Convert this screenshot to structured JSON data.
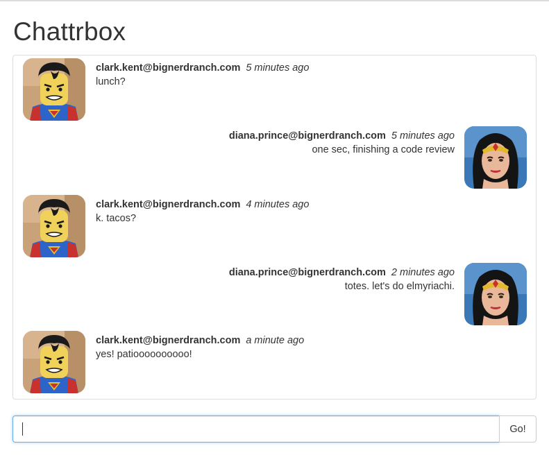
{
  "app": {
    "title": "Chattrbox"
  },
  "messages": [
    {
      "side": "left",
      "sender": "clark.kent@bignerdranch.com",
      "time": "5 minutes ago",
      "text": "lunch?",
      "avatar_icon": "superman-avatar"
    },
    {
      "side": "right",
      "sender": "diana.prince@bignerdranch.com",
      "time": "5 minutes ago",
      "text": "one sec, finishing a code review",
      "avatar_icon": "wonder-woman-avatar"
    },
    {
      "side": "left",
      "sender": "clark.kent@bignerdranch.com",
      "time": "4 minutes ago",
      "text": "k. tacos?",
      "avatar_icon": "superman-avatar"
    },
    {
      "side": "right",
      "sender": "diana.prince@bignerdranch.com",
      "time": "2 minutes ago",
      "text": "totes. let's do elmyriachi.",
      "avatar_icon": "wonder-woman-avatar"
    },
    {
      "side": "left",
      "sender": "clark.kent@bignerdranch.com",
      "time": "a minute ago",
      "text": "yes! patioooooooooo!",
      "avatar_icon": "superman-avatar"
    }
  ],
  "compose": {
    "value": "",
    "placeholder": "",
    "send_label": "Go!"
  },
  "colors": {
    "text": "#333333",
    "panel_border": "#dddddd",
    "input_focus": "#66afe9"
  }
}
